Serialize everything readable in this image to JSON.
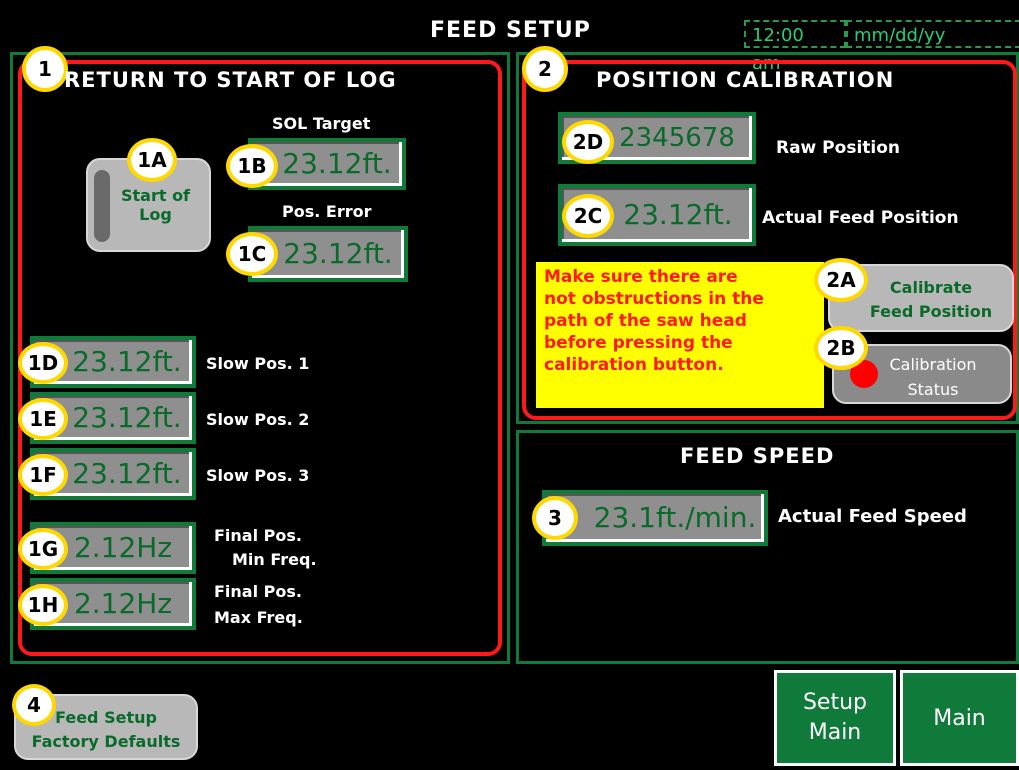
{
  "header": {
    "title": "FEED SETUP",
    "time": "12:00 am",
    "date": "mm/dd/yy"
  },
  "section1": {
    "badge": "1",
    "title": "RETURN TO START OF LOG",
    "start_badge": "1A",
    "start_button": [
      "Start of",
      "Log"
    ],
    "sol_target_label": "SOL Target",
    "sol_badge": "1B",
    "sol_value": "23.12ft.",
    "pos_error_label": "Pos. Error",
    "pos_error_badge": "1C",
    "pos_error_value": "23.12ft.",
    "slow_positions": [
      {
        "badge": "1D",
        "value": "23.12ft.",
        "label": "Slow Pos. 1"
      },
      {
        "badge": "1E",
        "value": "23.12ft.",
        "label": "Slow Pos. 2"
      },
      {
        "badge": "1F",
        "value": "23.12ft.",
        "label": "Slow Pos. 3"
      }
    ],
    "final_min": {
      "badge": "1G",
      "value": "2.12Hz",
      "label1": "Final Pos.",
      "label2": "Min Freq."
    },
    "final_max": {
      "badge": "1H",
      "value": "2.12Hz",
      "label1": "Final Pos.",
      "label2": "Max Freq."
    }
  },
  "section2": {
    "badge": "2",
    "title": "POSITION CALIBRATION",
    "raw_badge": "2D",
    "raw_value": "2345678",
    "raw_label": "Raw Position",
    "actual_badge": "2C",
    "actual_value": "23.12ft.",
    "actual_label": "Actual Feed Position",
    "warning": [
      "Make sure there are",
      "not obstructions in the",
      "path of the saw head",
      "before pressing the",
      "calibration button."
    ],
    "calibrate_badge": "2A",
    "calibrate_button": [
      "Calibrate",
      "Feed Position"
    ],
    "status_badge": "2B",
    "status_label": [
      "Calibration",
      "Status"
    ],
    "status_color": "#ff0000"
  },
  "section3": {
    "title": "FEED SPEED",
    "badge": "3",
    "value": "23.1ft./min.",
    "label": "Actual Feed Speed"
  },
  "footer": {
    "defaults_badge": "4",
    "defaults_button": [
      "Feed Setup",
      "Factory Defaults"
    ],
    "setup_main": [
      "Setup",
      "Main"
    ],
    "main": "Main"
  }
}
